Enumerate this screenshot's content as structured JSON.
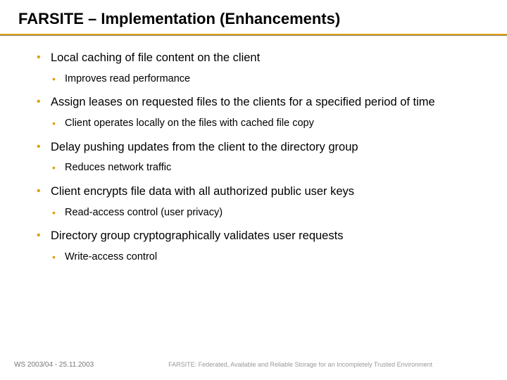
{
  "title": "FARSITE – Implementation (Enhancements)",
  "bullets": {
    "b1": "Local caching of file content on the client",
    "b1a": "Improves read performance",
    "b2": "Assign leases on requested files to the clients for a specified period of time",
    "b2a": "Client operates locally on the files with cached file copy",
    "b3": "Delay pushing updates from the client to the directory group",
    "b3a": "Reduces network traffic",
    "b4": "Client encrypts file data with all authorized public user keys",
    "b4a": "Read-access control (user privacy)",
    "b5": "Directory group cryptographically validates user requests",
    "b5a": "Write-access control"
  },
  "footer": {
    "left": "WS 2003/04 - 25.11.2003",
    "center": "FARSITE: Federated, Available and Reliable Storage for an Incompletely Trusted Environment"
  }
}
